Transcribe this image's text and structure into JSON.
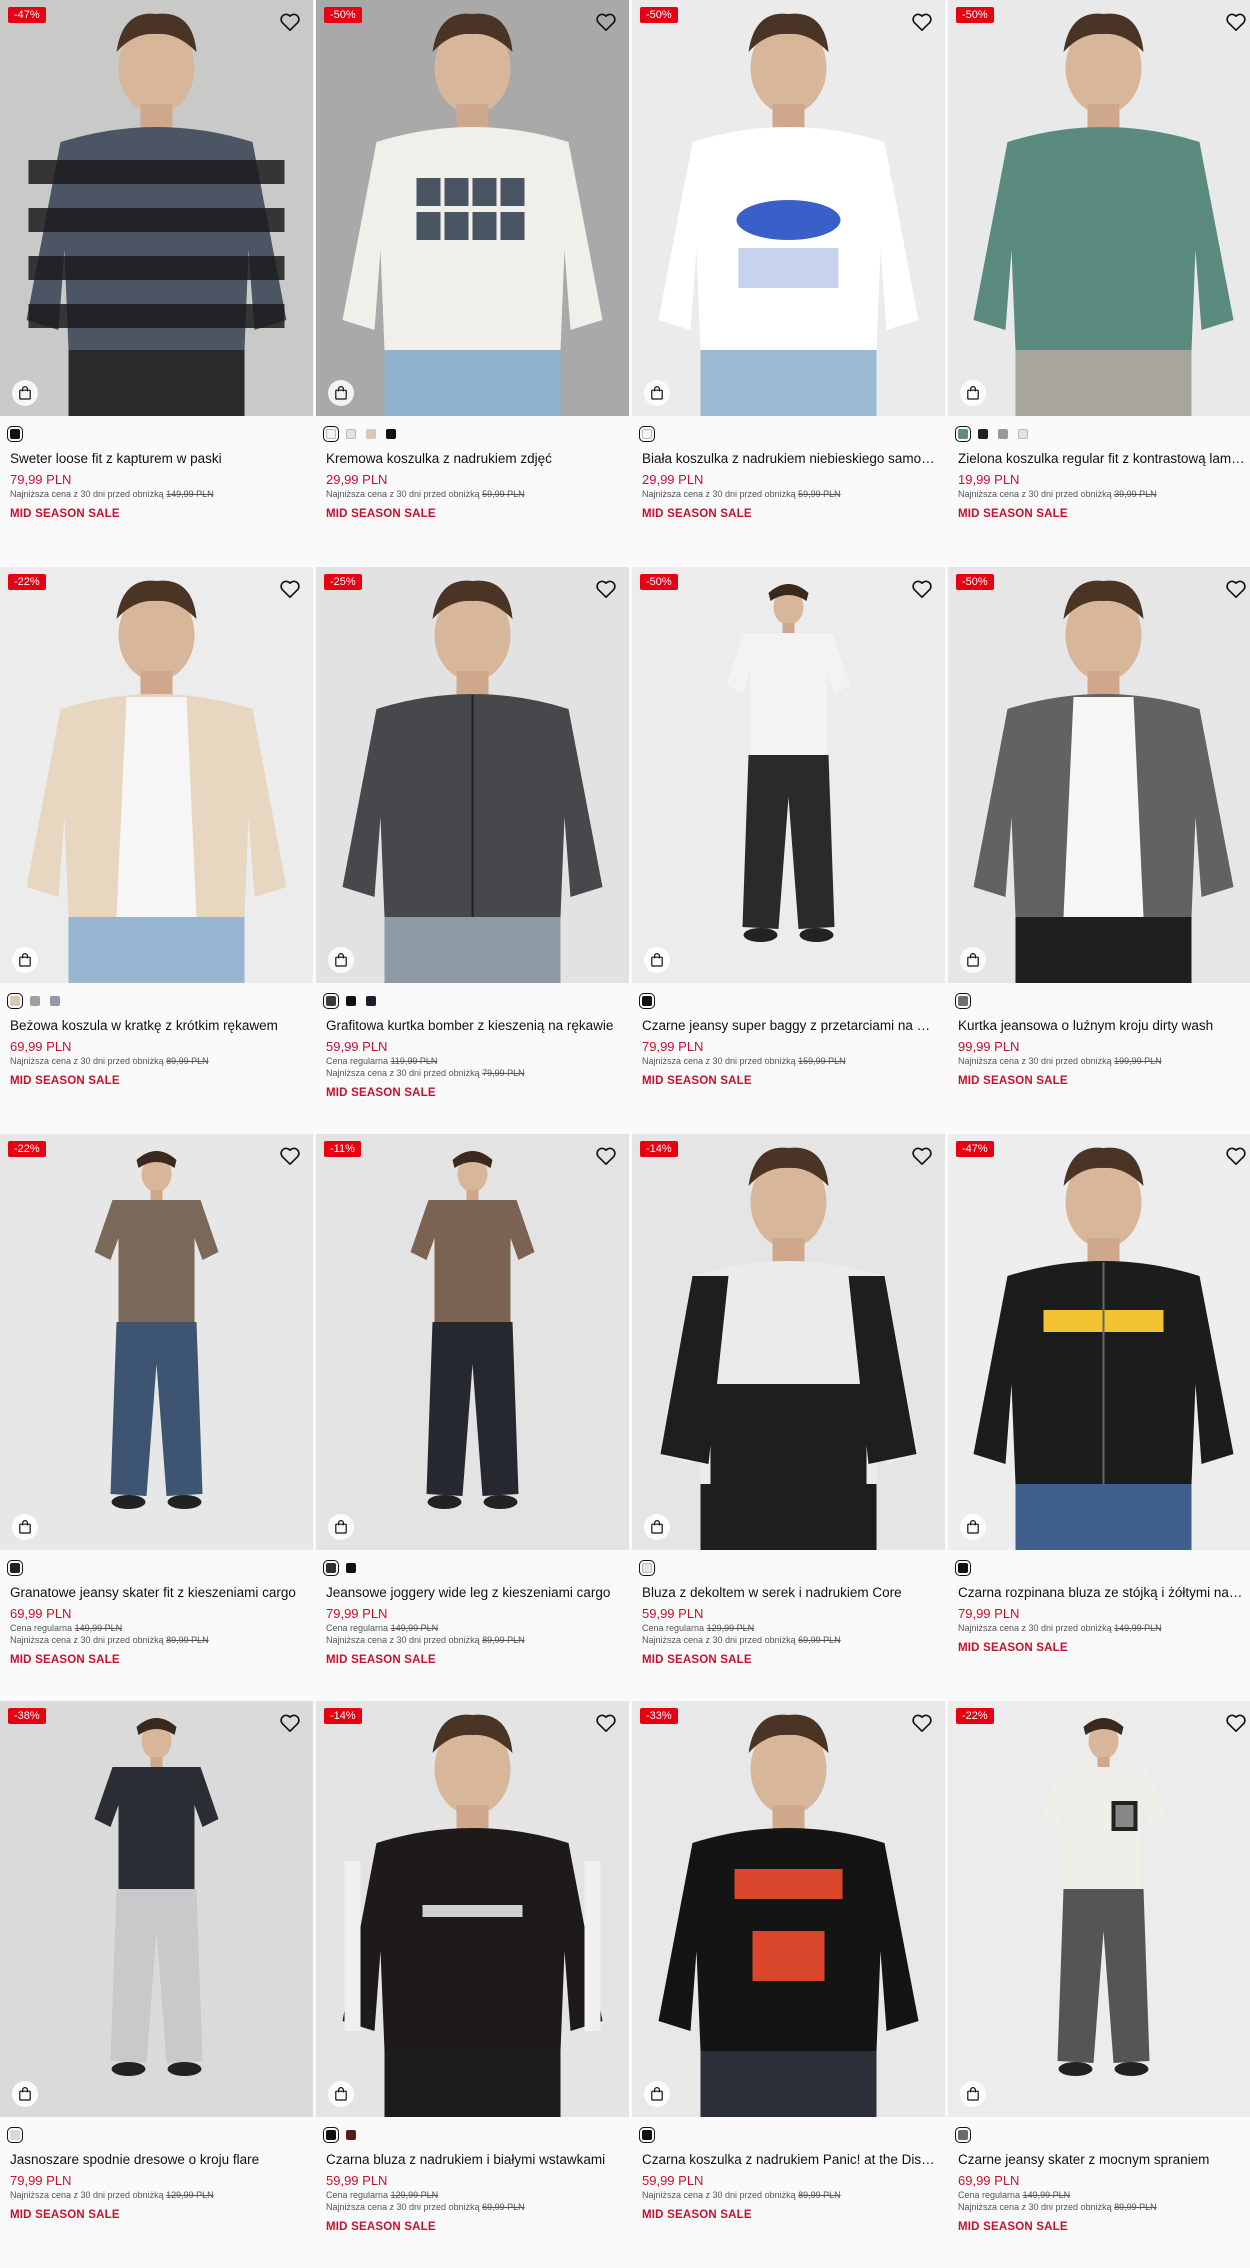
{
  "colors": {
    "sale_red": "#c8102e",
    "badge_red": "#e60012"
  },
  "products": [
    {
      "discount": "-47%",
      "swatches": [
        "#111111"
      ],
      "selected": 0,
      "name": "Sweter loose fit z kapturem w paski",
      "price": "79,99 PLN",
      "regular": "",
      "lowest_label": "Najniższa cena z 30 dni przed obniżką",
      "lowest": "149,99 PLN",
      "tag": "MID SEASON SALE",
      "bg": "#c9c9c7",
      "top": "#4b5563",
      "bottom": "#2a2a2a",
      "stripes": true,
      "print": ""
    },
    {
      "discount": "-50%",
      "swatches": [
        "#f4f3ef",
        "#e5e3dd",
        "#d7c9b4",
        "#111111"
      ],
      "selected": 0,
      "name": "Kremowa koszulka z nadrukiem zdjęć",
      "price": "29,99 PLN",
      "regular": "",
      "lowest_label": "Najniższa cena z 30 dni przed obniżką",
      "lowest": "59,99 PLN",
      "tag": "MID SEASON SALE",
      "bg": "#a9a9a9",
      "top": "#f1efea",
      "bottom": "#8fb2cf",
      "stripes": false,
      "print": "photos"
    },
    {
      "discount": "-50%",
      "swatches": [
        "#f5f5f5"
      ],
      "selected": 0,
      "name": "Biała koszulka z nadrukiem niebieskiego samochodu",
      "price": "29,99 PLN",
      "regular": "",
      "lowest_label": "Najniższa cena z 30 dni przed obniżką",
      "lowest": "59,99 PLN",
      "tag": "MID SEASON SALE",
      "bg": "#ebebeb",
      "top": "#ffffff",
      "bottom": "#9cbad3",
      "stripes": false,
      "print": "car"
    },
    {
      "discount": "-50%",
      "swatches": [
        "#5f8a80",
        "#222222",
        "#9a9a95",
        "#e5e3dd"
      ],
      "selected": 0,
      "name": "Zielona koszulka regular fit z kontrastową lamówką",
      "price": "19,99 PLN",
      "regular": "",
      "lowest_label": "Najniższa cena z 30 dni przed obniżką",
      "lowest": "39,99 PLN",
      "tag": "MID SEASON SALE",
      "bg": "#e9e9e9",
      "top": "#5b8a7f",
      "bottom": "#a7a59d",
      "stripes": false,
      "print": ""
    },
    {
      "discount": "-22%",
      "swatches": [
        "#d9c8b0",
        "#9aa0a6",
        "#8f9aa8"
      ],
      "selected": 0,
      "name": "Beżowa koszula w kratkę z krótkim rękawem",
      "price": "69,99 PLN",
      "regular": "",
      "lowest_label": "Najniższa cena z 30 dni przed obniżką",
      "lowest": "89,99 PLN",
      "tag": "MID SEASON SALE",
      "bg": "#ececec",
      "top": "#e8d7c0",
      "bottom": "#98b6d1",
      "stripes": false,
      "print": "open"
    },
    {
      "discount": "-25%",
      "swatches": [
        "#3a3a3a",
        "#111111",
        "#1c1f2a"
      ],
      "selected": 0,
      "name": "Grafitowa kurtka bomber z kieszenią na rękawie",
      "price": "59,99 PLN",
      "regular": "119,99 PLN",
      "regular_label": "Cena regularna",
      "lowest_label": "Najniższa cena z 30 dni przed obniżką",
      "lowest": "79,99 PLN",
      "tag": "MID SEASON SALE",
      "bg": "#e2e2e2",
      "top": "#46484b",
      "bottom": "#8d99a5",
      "stripes": false,
      "print": "zip"
    },
    {
      "discount": "-50%",
      "swatches": [
        "#111111"
      ],
      "selected": 0,
      "name": "Czarne jeansy super baggy z przetarciami na kolanach",
      "price": "79,99 PLN",
      "regular": "",
      "lowest_label": "Najniższa cena z 30 dni przed obniżką",
      "lowest": "159,99 PLN",
      "tag": "MID SEASON SALE",
      "bg": "#ececec",
      "top": "#f3f3f3",
      "bottom": "#2a2a2a",
      "stripes": false,
      "print": "",
      "full": true
    },
    {
      "discount": "-50%",
      "swatches": [
        "#6f6f6f"
      ],
      "selected": 0,
      "name": "Kurtka jeansowa o luźnym kroju dirty wash",
      "price": "99,99 PLN",
      "regular": "",
      "lowest_label": "Najniższa cena z 30 dni przed obniżką",
      "lowest": "199,99 PLN",
      "tag": "MID SEASON SALE",
      "bg": "#e6e6e6",
      "top": "#626262",
      "bottom": "#1f1f1f",
      "stripes": false,
      "print": "open"
    },
    {
      "discount": "-22%",
      "swatches": [
        "#1c2230"
      ],
      "selected": 0,
      "name": "Granatowe jeansy skater fit z kieszeniami cargo",
      "price": "69,99 PLN",
      "regular": "149,99 PLN",
      "regular_label": "Cena regularna",
      "lowest_label": "Najniższa cena z 30 dni przed obniżką",
      "lowest": "89,99 PLN",
      "tag": "MID SEASON SALE",
      "bg": "#e7e7e7",
      "top": "#7a6858",
      "bottom": "#3d5573",
      "stripes": false,
      "print": "",
      "full": true
    },
    {
      "discount": "-11%",
      "swatches": [
        "#2f2f2f",
        "#111111"
      ],
      "selected": 0,
      "name": "Jeansowe joggery wide leg z kieszeniami cargo",
      "price": "79,99 PLN",
      "regular": "149,99 PLN",
      "regular_label": "Cena regularna",
      "lowest_label": "Najniższa cena z 30 dni przed obniżką",
      "lowest": "89,99 PLN",
      "tag": "MID SEASON SALE",
      "bg": "#e3e3e3",
      "top": "#7a6353",
      "bottom": "#25282e",
      "stripes": false,
      "print": "",
      "full": true
    },
    {
      "discount": "-14%",
      "swatches": [
        "#e6e6e6"
      ],
      "selected": 0,
      "name": "Bluza z dekoltem w serek i nadrukiem Core",
      "price": "59,99 PLN",
      "regular": "129,99 PLN",
      "regular_label": "Cena regularna",
      "lowest_label": "Najniższa cena z 30 dni przed obniżką",
      "lowest": "69,99 PLN",
      "tag": "MID SEASON SALE",
      "bg": "#e5e5e5",
      "top": "#ebebeb",
      "bottom": "#1e1e1e",
      "stripes": false,
      "print": "core"
    },
    {
      "discount": "-47%",
      "swatches": [
        "#111111"
      ],
      "selected": 0,
      "name": "Czarna rozpinana bluza ze stójką i żółtymi nadrukami",
      "price": "79,99 PLN",
      "regular": "",
      "lowest_label": "Najniższa cena z 30 dni przed obniżką",
      "lowest": "149,99 PLN",
      "tag": "MID SEASON SALE",
      "bg": "#ededed",
      "top": "#1c1c1c",
      "bottom": "#3f5f8d",
      "stripes": false,
      "print": "flame"
    },
    {
      "discount": "-38%",
      "swatches": [
        "#d9d9d9"
      ],
      "selected": 0,
      "name": "Jasnoszare spodnie dresowe o kroju flare",
      "price": "79,99 PLN",
      "regular": "",
      "lowest_label": "Najniższa cena z 30 dni przed obniżką",
      "lowest": "129,99 PLN",
      "tag": "MID SEASON SALE",
      "bg": "#dadada",
      "top": "#2a2d33",
      "bottom": "#c9c9cb",
      "stripes": false,
      "print": "",
      "full": true
    },
    {
      "discount": "-14%",
      "swatches": [
        "#111111",
        "#5a1a1a"
      ],
      "selected": 0,
      "name": "Czarna bluza z nadrukiem i białymi wstawkami",
      "price": "59,99 PLN",
      "regular": "129,99 PLN",
      "regular_label": "Cena regularna",
      "lowest_label": "Najniższa cena z 30 dni przed obniżką",
      "lowest": "69,99 PLN",
      "tag": "MID SEASON SALE",
      "bg": "#e4e4e4",
      "top": "#1e1a1a",
      "bottom": "#1c1c1c",
      "stripes": false,
      "print": "physica"
    },
    {
      "discount": "-33%",
      "swatches": [
        "#111111"
      ],
      "selected": 0,
      "name": "Czarna koszulka z nadrukiem Panic! at the Disco",
      "price": "59,99 PLN",
      "regular": "",
      "lowest_label": "Najniższa cena z 30 dni przed obniżką",
      "lowest": "89,99 PLN",
      "tag": "MID SEASON SALE",
      "bg": "#e8e8e8",
      "top": "#141414",
      "bottom": "#2b2f38",
      "stripes": false,
      "print": "panic"
    },
    {
      "discount": "-22%",
      "swatches": [
        "#6a6a6a"
      ],
      "selected": 0,
      "name": "Czarne jeansy skater z mocnym spraniem",
      "price": "69,99 PLN",
      "regular": "149,99 PLN",
      "regular_label": "Cena regularna",
      "lowest_label": "Najniższa cena z 30 dni przed obniżką",
      "lowest": "89,99 PLN",
      "tag": "MID SEASON SALE",
      "bg": "#ececec",
      "top": "#f0eee9",
      "bottom": "#555555",
      "stripes": false,
      "print": "patch",
      "full": true
    }
  ]
}
